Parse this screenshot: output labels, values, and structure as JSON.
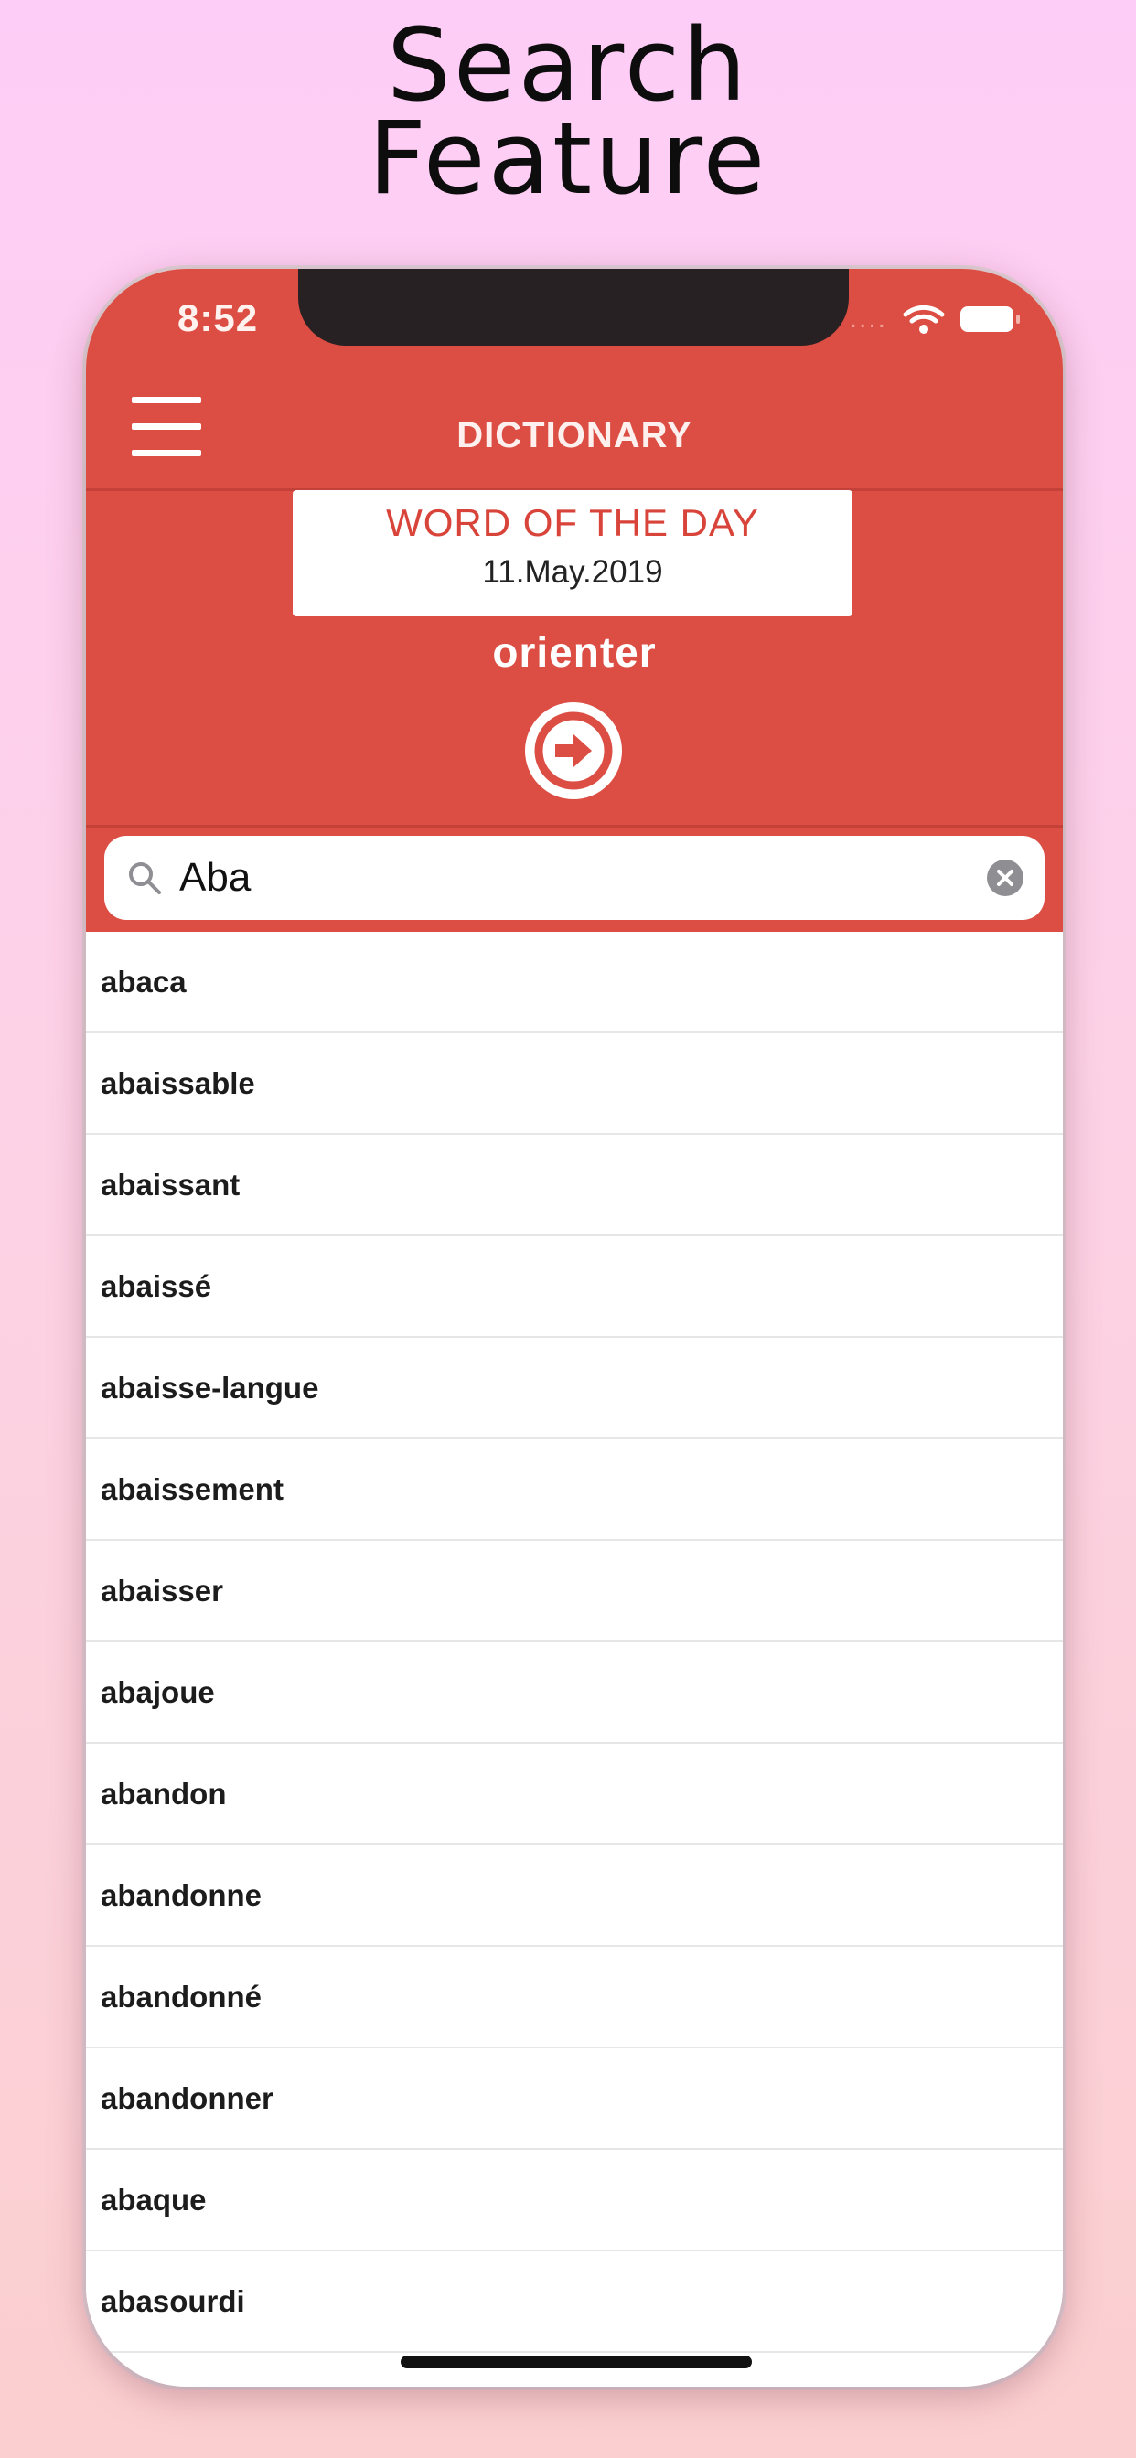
{
  "promo": {
    "line1": "Search",
    "line2": "Feature"
  },
  "status_bar": {
    "time": "8:52",
    "signal_dots": "....",
    "icons": [
      "wifi-icon",
      "battery-icon"
    ]
  },
  "nav": {
    "menu_icon": "hamburger-menu-icon",
    "title": "DICTIONARY"
  },
  "word_of_the_day": {
    "heading": "WORD OF THE DAY",
    "date": "11.May.2019",
    "word": "orienter",
    "go_icon": "arrow-right-circle-icon"
  },
  "search": {
    "value": "Aba",
    "placeholder": "",
    "icon": "search-icon",
    "clear_icon": "clear-icon"
  },
  "results": [
    "abaca",
    "abaissable",
    "abaissant",
    "abaissé",
    "abaisse-langue",
    "abaissement",
    "abaisser",
    "abajoue",
    "abandon",
    "abandonne",
    "abandonné",
    "abandonner",
    "abaque",
    "abasourdi"
  ],
  "colors": {
    "primary_red": "#dc4e43",
    "accent_red": "#d8443a",
    "background_top": "#fecdf7",
    "background_bottom": "#fbcfcf"
  }
}
